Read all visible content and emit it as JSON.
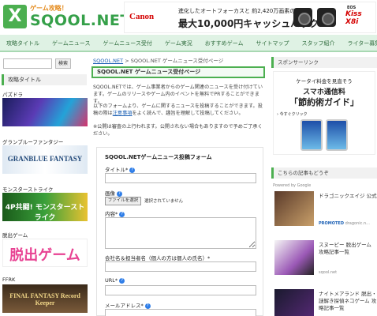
{
  "header": {
    "logo_tagline": "ゲーム攻略！",
    "logo_name": "SQOOL.NET",
    "logo_mark": "X"
  },
  "banner_ad": {
    "brand": "Canon",
    "line1": "進化したオートフォーカスと 約2,420万画素の高画質",
    "line2": "最大10,000円キャッシュバック",
    "model_small": "EOS",
    "model_name": "Kiss X8i"
  },
  "nav": {
    "items": [
      "攻略タイトル",
      "ゲームニュース",
      "ゲームニュース受付",
      "ゲーム実況",
      "おすすめゲーム",
      "サイトマップ",
      "スタッフ紹介",
      "ライター募集"
    ]
  },
  "sidebar_left": {
    "search_placeholder": "",
    "search_button": "検索",
    "heading": "攻略タイトル",
    "games": [
      {
        "title": "パズドラ",
        "image_text": ""
      },
      {
        "title": "グランブルーファンタジー",
        "image_text": "GRANBLUE FANTASY"
      },
      {
        "title": "モンスターストライク",
        "image_text": "4P共闘! モンスターストライク"
      },
      {
        "title": "脱出ゲーム",
        "image_text": "脱出ゲーム"
      },
      {
        "title": "FFRK",
        "image_text": "FINAL FANTASY Record Keeper"
      }
    ]
  },
  "main": {
    "breadcrumb_home": "SQOOL.NET",
    "breadcrumb_sep": ">",
    "breadcrumb_current": "SQOOL.NET ゲームニュース受付ページ",
    "page_title": "SQOOL.NET ゲームニュース受付ページ",
    "para1": "SQOOL.NETでは、ゲーム事業者からのゲーム関連のニュースを受け付けています。ゲームのリリースやゲーム内のイベントを無料でPRすることができます。",
    "para2_prefix": "以下のフォームより、ゲームに関するニュースを投稿することができます。投稿の際は",
    "para2_link": "注意事項",
    "para2_suffix": "をよく読んで、趣旨を理解して投稿してください。",
    "para3": "※公開は審査の上行われます。公開されない場合もありますので予めご了承ください。",
    "form": {
      "title": "SQOOL.NETゲームニュース投稿フォーム",
      "title_label": "タイトル",
      "required_mark": "*",
      "help_mark": "?",
      "image_label": "画像",
      "file_button": "ファイルを選択",
      "file_status": "選択されていません",
      "content_label": "内容",
      "company_label": "会社名＆担当者名（個人の方は個人の氏名）",
      "url_label": "URL",
      "email_label": "メールアドレス"
    }
  },
  "sidebar_right": {
    "sponsored_heading": "スポンサーリンク",
    "ad": {
      "line1": "ケータイ料金を見直そう",
      "line2": "スマホ通信料",
      "line3": "「節約術ガイド」",
      "cta": "› 今すぐクリック"
    },
    "recommend_heading": "こちらの記事もどうぞ",
    "powered_by": "Powered by Google",
    "articles": [
      {
        "title": "ドラゴニックエイジ 公式",
        "source": "dragonic.n...",
        "promo": "PROMOTED"
      },
      {
        "title": "スヌーピー 脱出ゲーム 攻略記事一覧",
        "source": "sqool.net",
        "promo": ""
      },
      {
        "title": "ナイトメアランド 脱出・謎解き探偵ネコゲーム 攻略記事一覧",
        "source": "",
        "promo": ""
      }
    ]
  },
  "colors": {
    "brand_green": "#35a049",
    "nav_bg": "#dff2e4",
    "link": "#1a5fb4",
    "help_icon": "#2f7ee8",
    "canon_red": "#d40000"
  }
}
